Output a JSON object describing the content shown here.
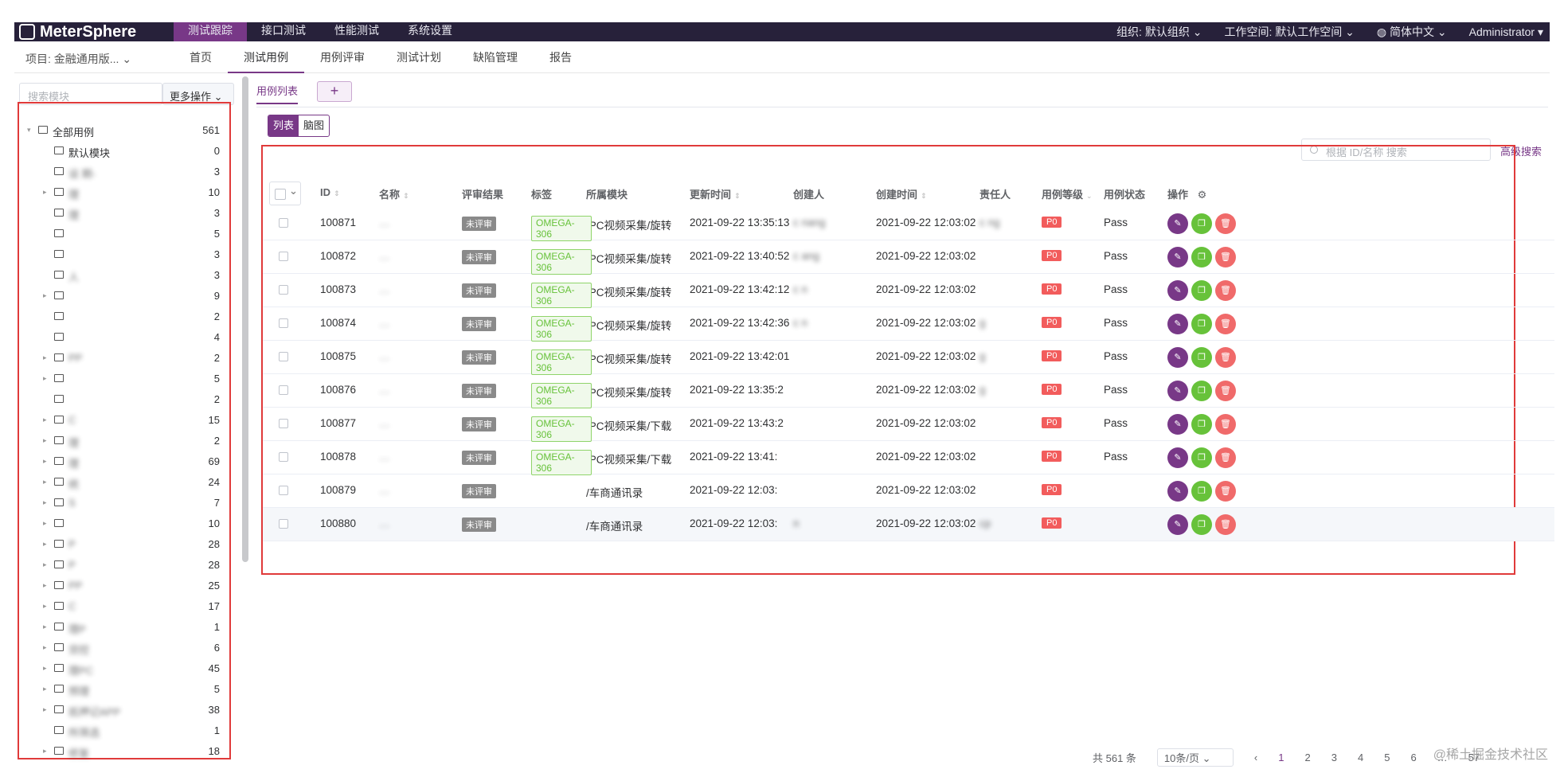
{
  "topbar": {
    "logo": "MeterSphere",
    "nav": [
      "测试跟踪",
      "接口测试",
      "性能测试",
      "系统设置"
    ],
    "org_label": "组织:",
    "org_value": "默认组织",
    "workspace_label": "工作空间:",
    "workspace_value": "默认工作空间",
    "language": "简体中文",
    "user": "Administrator"
  },
  "subnav": {
    "project": "项目: 金融通用版...",
    "tabs": [
      "首页",
      "测试用例",
      "用例评审",
      "测试计划",
      "缺陷管理",
      "报告"
    ]
  },
  "left": {
    "search_placeholder": "搜索模块",
    "more_ops": "更多操作",
    "tree": [
      {
        "label": "全部用例",
        "count": "561",
        "expand": "▾"
      },
      {
        "label": "默认模块",
        "count": "0",
        "expand": ""
      },
      {
        "label": "设 期-",
        "count": "3",
        "expand": ""
      },
      {
        "label": "理",
        "count": "10",
        "expand": "▸"
      },
      {
        "label": "理",
        "count": "3",
        "expand": ""
      },
      {
        "label": "",
        "count": "5",
        "expand": ""
      },
      {
        "label": "",
        "count": "3",
        "expand": ""
      },
      {
        "label": "人",
        "count": "3",
        "expand": ""
      },
      {
        "label": "",
        "count": "9",
        "expand": "▸"
      },
      {
        "label": "",
        "count": "2",
        "expand": ""
      },
      {
        "label": "",
        "count": "4",
        "expand": ""
      },
      {
        "label": "PP",
        "count": "2",
        "expand": "▸"
      },
      {
        "label": "",
        "count": "5",
        "expand": "▸"
      },
      {
        "label": "",
        "count": "2",
        "expand": ""
      },
      {
        "label": "C",
        "count": "15",
        "expand": "▸"
      },
      {
        "label": "理",
        "count": "2",
        "expand": "▸"
      },
      {
        "label": "理",
        "count": "69",
        "expand": "▸"
      },
      {
        "label": "统",
        "count": "24",
        "expand": "▸"
      },
      {
        "label": "S",
        "count": "7",
        "expand": "▸"
      },
      {
        "label": "",
        "count": "10",
        "expand": "▸"
      },
      {
        "label": "P",
        "count": "28",
        "expand": "▸"
      },
      {
        "label": "P",
        "count": "28",
        "expand": "▸"
      },
      {
        "label": "PP",
        "count": "25",
        "expand": "▸"
      },
      {
        "label": "C",
        "count": "17",
        "expand": "▸"
      },
      {
        "label": "理P",
        "count": "1",
        "expand": "▸"
      },
      {
        "label": "贷控",
        "count": "6",
        "expand": "▸"
      },
      {
        "label": "理PC",
        "count": "45",
        "expand": "▸"
      },
      {
        "label": "预理",
        "count": "5",
        "expand": "▸"
      },
      {
        "label": "抵押记APP",
        "count": "38",
        "expand": "▸"
      },
      {
        "label": "所筛选",
        "count": "1",
        "expand": ""
      },
      {
        "label": "修复",
        "count": "18",
        "expand": "▸"
      }
    ]
  },
  "main": {
    "tab_label": "用例列表",
    "add_label": "+",
    "view_list": "列表",
    "view_mind": "脑图",
    "search_placeholder": "根据 ID/名称 搜索",
    "adv_search": "高级搜索",
    "headers": {
      "id": "ID",
      "name": "名称",
      "review": "评审结果",
      "tag": "标签",
      "module": "所属模块",
      "updated": "更新时间",
      "creator": "创建人",
      "created": "创建时间",
      "owner": "责任人",
      "level": "用例等级",
      "status": "用例状态",
      "ops": "操作"
    },
    "rows": [
      {
        "id": "100871",
        "name": "…",
        "review": "未评审",
        "tag": "OMEGA-306",
        "module": "/PC视频采集/旋转",
        "updated": "2021-09-22 13:35:13",
        "creator": "c  nang",
        "created": "2021-09-22 12:03:02",
        "owner": "c  ng",
        "level": "P0",
        "status": "Pass"
      },
      {
        "id": "100872",
        "name": "…",
        "review": "未评审",
        "tag": "OMEGA-306",
        "module": "/PC视频采集/旋转",
        "updated": "2021-09-22 13:40:52",
        "creator": "c  ang",
        "created": "2021-09-22 12:03:02",
        "owner": "",
        "level": "P0",
        "status": "Pass"
      },
      {
        "id": "100873",
        "name": "…",
        "review": "未评审",
        "tag": "OMEGA-306",
        "module": "/PC视频采集/旋转",
        "updated": "2021-09-22 13:42:12",
        "creator": "c  n",
        "created": "2021-09-22 12:03:02",
        "owner": "",
        "level": "P0",
        "status": "Pass"
      },
      {
        "id": "100874",
        "name": "…",
        "review": "未评审",
        "tag": "OMEGA-306",
        "module": "/PC视频采集/旋转",
        "updated": "2021-09-22 13:42:36",
        "creator": "c  n",
        "created": "2021-09-22 12:03:02",
        "owner": "g",
        "level": "P0",
        "status": "Pass"
      },
      {
        "id": "100875",
        "name": "…",
        "review": "未评审",
        "tag": "OMEGA-306",
        "module": "/PC视频采集/旋转",
        "updated": "2021-09-22 13:42:01",
        "creator": "",
        "created": "2021-09-22 12:03:02",
        "owner": "g",
        "level": "P0",
        "status": "Pass"
      },
      {
        "id": "100876",
        "name": "…",
        "review": "未评审",
        "tag": "OMEGA-306",
        "module": "/PC视频采集/旋转",
        "updated": "2021-09-22 13:35:2",
        "creator": "",
        "created": "2021-09-22 12:03:02",
        "owner": "g",
        "level": "P0",
        "status": "Pass"
      },
      {
        "id": "100877",
        "name": "…",
        "review": "未评审",
        "tag": "OMEGA-306",
        "module": "/PC视频采集/下载",
        "updated": "2021-09-22 13:43:2",
        "creator": "",
        "created": "2021-09-22 12:03:02",
        "owner": "",
        "level": "P0",
        "status": "Pass"
      },
      {
        "id": "100878",
        "name": "…",
        "review": "未评审",
        "tag": "OMEGA-306",
        "module": "/PC视频采集/下载",
        "updated": "2021-09-22 13:41:",
        "creator": "",
        "created": "2021-09-22 12:03:02",
        "owner": "",
        "level": "P0",
        "status": "Pass"
      },
      {
        "id": "100879",
        "name": "…",
        "review": "未评审",
        "tag": "",
        "module": "/车商通讯录",
        "updated": "2021-09-22 12:03:",
        "creator": "",
        "created": "2021-09-22 12:03:02",
        "owner": "",
        "level": "P0",
        "status": ""
      },
      {
        "id": "100880",
        "name": "…",
        "review": "未评审",
        "tag": "",
        "module": "/车商通讯录",
        "updated": "2021-09-22 12:03:",
        "creator": "  n",
        "created": "2021-09-22 12:03:02",
        "owner": "cp",
        "level": "P0",
        "status": ""
      }
    ],
    "pager": {
      "total": "共 561 条",
      "size": "10条/页",
      "pages": [
        "1",
        "2",
        "3",
        "4",
        "5",
        "6",
        "57"
      ]
    }
  },
  "watermark": "@稀土掘金技术社区",
  "colors": {
    "brand": "#783887",
    "topbar": "#27213a",
    "highlight_border": "#e03a3a"
  }
}
